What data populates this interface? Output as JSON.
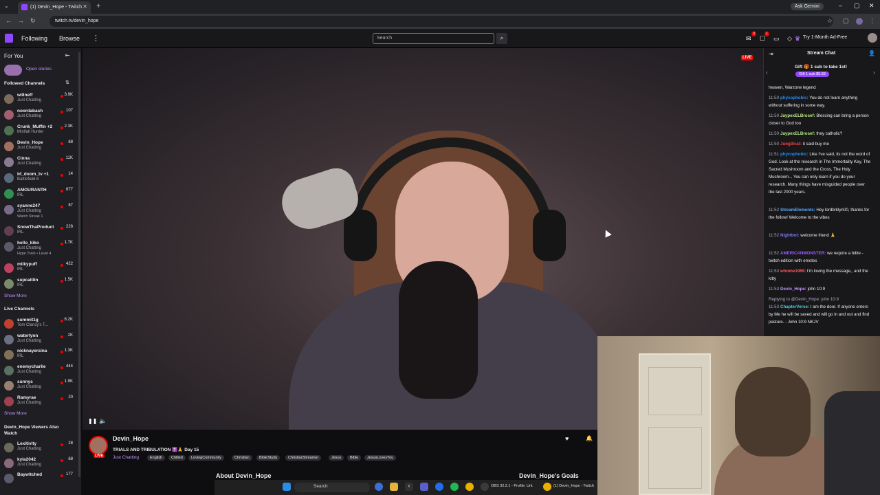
{
  "browser": {
    "tab_title": "(1) Devin_Hope - Twitch",
    "url": "twitch.tv/devin_hope",
    "gemini_label": "Ask Gemini"
  },
  "topnav": {
    "following": "Following",
    "browse": "Browse",
    "search_placeholder": "Search",
    "prime_label": "Try 1-Month Ad-Free",
    "inbox_badge": "3",
    "notif_badge": "1"
  },
  "sidebar": {
    "for_you": "For You",
    "open_stories": "Open stories",
    "followed_header": "Followed Channels",
    "followed": [
      {
        "name": "willneff",
        "category": "Just Chatting",
        "viewers": "3.9K",
        "color": "#7d6a5a"
      },
      {
        "name": "noordabash",
        "category": "Just Chatting",
        "viewers": "107",
        "color": "#a06070"
      },
      {
        "name": "Crunk_Muffin +2",
        "category": "Mistfall Hunter",
        "viewers": "2.3K",
        "color": "#507050"
      },
      {
        "name": "Devin_Hope",
        "category": "Just Chatting",
        "viewers": "88",
        "color": "#a07060"
      },
      {
        "name": "Cinna",
        "category": "Just Chatting",
        "viewers": "11K",
        "color": "#8a7a90"
      },
      {
        "name": "bf_doom_tv +1",
        "category": "Battlefield 6",
        "viewers": "14",
        "color": "#5a6a7a"
      },
      {
        "name": "AMOURANTH",
        "category": "IRL",
        "viewers": "677",
        "color": "#309050"
      },
      {
        "name": "syanne247",
        "category": "Just Chatting",
        "viewers": "87",
        "color": "#7a6a8a",
        "extra": "Watch Streak 1"
      },
      {
        "name": "SnowThaProduct",
        "category": "IRL",
        "viewers": "228",
        "color": "#604050"
      },
      {
        "name": "hello_kiko",
        "category": "Just Chatting",
        "viewers": "1.7K",
        "color": "#5a5a6a",
        "extra": "Hype Train • Level 4"
      },
      {
        "name": "milkypuff",
        "category": "IRL",
        "viewers": "422",
        "color": "#c04060"
      },
      {
        "name": "supcaitlin",
        "category": "IRL",
        "viewers": "1.5K",
        "color": "#7a8a6a"
      }
    ],
    "show_more_1": "Show More",
    "live_header": "Live Channels",
    "live": [
      {
        "name": "summit1g",
        "category": "Tom Clancy's T...",
        "viewers": "6.2K",
        "color": "#c04030"
      },
      {
        "name": "waterlynn",
        "category": "Just Chatting",
        "viewers": "2K",
        "color": "#6a7080"
      },
      {
        "name": "nicknayersina",
        "category": "IRL",
        "viewers": "1.3K",
        "color": "#80705a"
      },
      {
        "name": "enemycharlie",
        "category": "Just Chatting",
        "viewers": "444",
        "color": "#5a7060"
      },
      {
        "name": "sunnys",
        "category": "Just Chatting",
        "viewers": "1.9K",
        "color": "#9a8070"
      },
      {
        "name": "Ramyrae",
        "category": "Just Chatting",
        "viewers": "20",
        "color": "#a04050"
      }
    ],
    "show_more_2": "Show More",
    "also_watch_header": "Devin_Hope Viewers Also Watch",
    "also": [
      {
        "name": "Lexitivity",
        "category": "Just Chatting",
        "viewers": "28",
        "color": "#6a6a5a"
      },
      {
        "name": "kyla2042",
        "category": "Just Chatting",
        "viewers": "68",
        "color": "#8a6a7a"
      },
      {
        "name": "Baywitched",
        "category": "",
        "viewers": "177",
        "color": "#5a5a6a"
      }
    ]
  },
  "player": {
    "live_badge": "LIVE"
  },
  "stream": {
    "streamer": "Devin_Hope",
    "live_badge": "LIVE",
    "title": "TRIALS AND TRIBULATION ✝️🙏 Day 15",
    "category": "Just Chatting",
    "tags": [
      "English",
      "Chilled",
      "LovingCommunity",
      "Christian",
      "BibleStudy",
      "ChristianStreamer",
      "Jesus",
      "Bible",
      "JesusLovesYou"
    ],
    "about": "About Devin_Hope",
    "goals": "Devin_Hope's Goals"
  },
  "chat": {
    "title": "Stream Chat",
    "gift_text": "Gift 🎁 1 sub to take 1st!",
    "gift_button": "Gift 1 sub $5.99",
    "messages": [
      {
        "time": "",
        "user": "",
        "user_color": "#efeff1",
        "text": "heaven, Warzone legend"
      },
      {
        "time": "11:50",
        "user": "phycophobic:",
        "user_color": "#1e90ff",
        "text": "You do not learn anything without suffering in some way."
      },
      {
        "time": "11:50",
        "user": "JaypexELBrosef:",
        "user_color": "#b8e986",
        "text": "Blessing can bring a person closer to God too"
      },
      {
        "time": "11:50",
        "user": "JaypexELBrosef:",
        "user_color": "#b8e986",
        "text": "they catholic?"
      },
      {
        "time": "11:50",
        "user": "Jung3lcat:",
        "user_color": "#ff4040",
        "text": "it said buy me"
      },
      {
        "time": "11:51",
        "user": "phycophobic:",
        "user_color": "#1e90ff",
        "text": "Like I've said, its not the word of God. Look at the research in The Immortality Key, The Sacred Mushroom and the Cross, The Holy Mushroom... You can only learn if you do your research. Many things have misguided people over the last 2000 years."
      },
      {
        "time": "11:52",
        "user": "StreamElements:",
        "user_color": "#5aa9ff",
        "text": "Hey lordbrklyn00, thanks for the follow! Welcome to the vibes"
      },
      {
        "time": "11:52",
        "user": "Nightbot:",
        "user_color": "#7c7cff",
        "text": "welcome friend 🙏"
      },
      {
        "time": "11:52",
        "user": "AMERICANMONSTER:",
        "user_color": "#9b59ff",
        "text": "we require a bible - twitch edition with emotes"
      },
      {
        "time": "11:53",
        "user": "whome1969:",
        "user_color": "#ff5a5a",
        "text": "I'm loving the message,, and the kitty"
      },
      {
        "time": "11:53",
        "user": "Devin_Hope:",
        "user_color": "#bf94ff",
        "text": "john 10:9"
      },
      {
        "time": "",
        "user": "",
        "user_color": "#adadb8",
        "text": "Replying to @Devin_Hope: john 10:9"
      },
      {
        "time": "11:53",
        "user": "ChapterVerse:",
        "user_color": "#4dd0e1",
        "text": "I am the door. If anyone enters by Me he will be saved and will go in and out and find pasture. - John 10:9 NKJV"
      }
    ]
  },
  "taskbar": {
    "search": "Search",
    "obs_label": "OBS 32.2.1 - Profile: Unt",
    "chrome_label": "(1) Devin_Hope - Twitch"
  }
}
